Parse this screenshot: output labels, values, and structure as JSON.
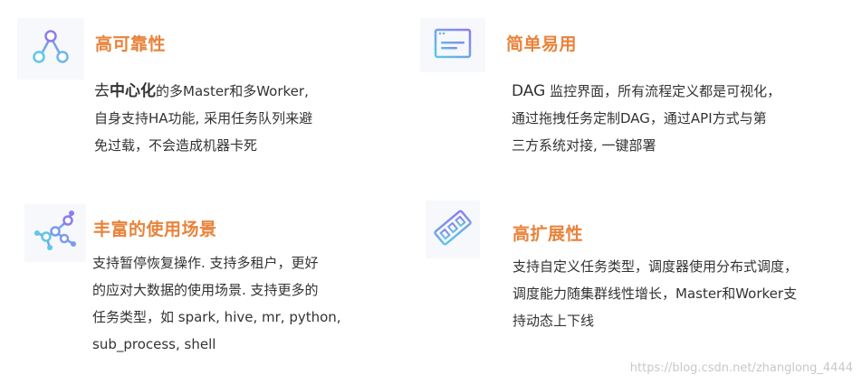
{
  "features": [
    {
      "title": "高可靠性",
      "icon": "network-triangle-icon",
      "lines": {
        "l1_prefix": "去",
        "l1_bold": "中心化",
        "l1_suffix": "的多Master和多Worker,",
        "l2": "自身支持HA功能, 采用任务队列来避",
        "l3": "免过载，不会造成机器卡死"
      }
    },
    {
      "title": "简单易用",
      "icon": "browser-window-icon",
      "lines": {
        "l1_prefix": "DAG",
        "l1_suffix": " 监控界面，所有流程定义都是可视化，",
        "l2": "通过拖拽任务定制DAG，通过API方式与第",
        "l3": "三方系统对接, 一键部署"
      }
    },
    {
      "title": "丰富的使用场景",
      "icon": "molecule-nodes-icon",
      "lines": {
        "l1": "支持暂停恢复操作. 支持多租户，更好",
        "l2": "的应对大数据的使用场景. 支持更多的",
        "l3": "任务类型，如 spark, hive, mr, python,",
        "l4": "sub_process, shell"
      }
    },
    {
      "title": "高扩展性",
      "icon": "memory-card-icon",
      "lines": {
        "l1": "支持自定义任务类型，调度器使用分布式调度，",
        "l2": "调度能力随集群线性增长，Master和Worker支",
        "l3": "持动态上下线"
      }
    }
  ],
  "watermark": "https://blog.csdn.net/zhanglong_4444",
  "colors": {
    "title": "#e8833a",
    "text": "#333333",
    "icon_gradient_start": "#5ec7e8",
    "icon_gradient_end": "#8a7cf0",
    "icon_bg": "#f7f8fb"
  }
}
